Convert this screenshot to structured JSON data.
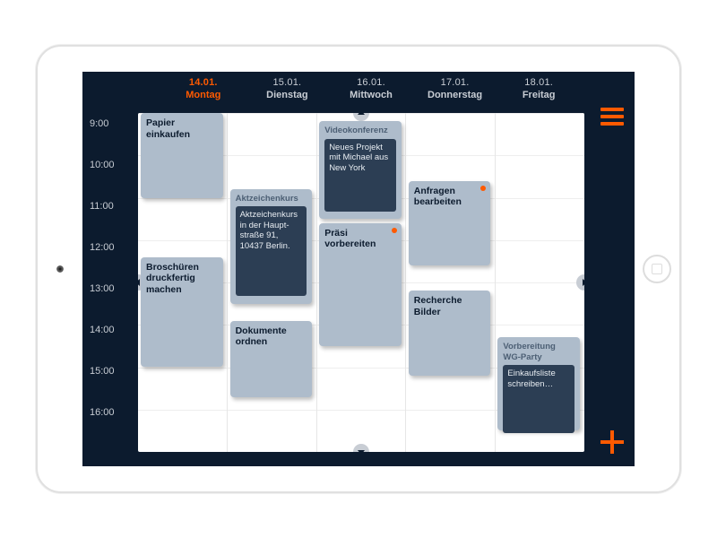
{
  "colors": {
    "bg": "#0c1b2e",
    "accent": "#ff5a00",
    "event_light": "#aebccb",
    "event_dark": "#2c3e54"
  },
  "days": [
    {
      "date": "14.01.",
      "name": "Montag",
      "active": true
    },
    {
      "date": "15.01.",
      "name": "Dienstag",
      "active": false
    },
    {
      "date": "16.01.",
      "name": "Mittwoch",
      "active": false
    },
    {
      "date": "17.01.",
      "name": "Donnerstag",
      "active": false
    },
    {
      "date": "18.01.",
      "name": "Freitag",
      "active": false
    }
  ],
  "hours": [
    "9:00",
    "10:00",
    "11:00",
    "12:00",
    "13:00",
    "14:00",
    "15:00",
    "16:00"
  ],
  "events": [
    {
      "col": 0,
      "start": 9.0,
      "end": 11.0,
      "kind": "light",
      "title": "Papier einkaufen"
    },
    {
      "col": 0,
      "start": 12.4,
      "end": 15.0,
      "kind": "light",
      "title": "Broschüren druckfertig machen"
    },
    {
      "col": 1,
      "start": 10.8,
      "end": 13.5,
      "kind": "dark",
      "header": "Aktzeichenkurs",
      "body": "Aktzeichenkurs in der Haupt­straße 91, 10437 Berlin."
    },
    {
      "col": 1,
      "start": 13.9,
      "end": 15.7,
      "kind": "light",
      "title": "Dokumente ordnen"
    },
    {
      "col": 2,
      "start": 9.2,
      "end": 11.5,
      "kind": "dark",
      "header": "Videokonferenz",
      "body": "Neues Projekt mit Michael aus New York"
    },
    {
      "col": 2,
      "start": 11.6,
      "end": 14.5,
      "kind": "light",
      "title": "Präsi vorbereiten",
      "dot": true
    },
    {
      "col": 3,
      "start": 10.6,
      "end": 12.6,
      "kind": "light",
      "title": "Anfragen bearbeiten",
      "dot": true
    },
    {
      "col": 3,
      "start": 13.2,
      "end": 15.2,
      "kind": "light",
      "title": "Recherche Bilder"
    },
    {
      "col": 4,
      "start": 14.3,
      "end": 16.5,
      "kind": "dark",
      "header": "Vorbereitung WG-Party",
      "body": "Einkaufsliste schreiben…"
    }
  ]
}
